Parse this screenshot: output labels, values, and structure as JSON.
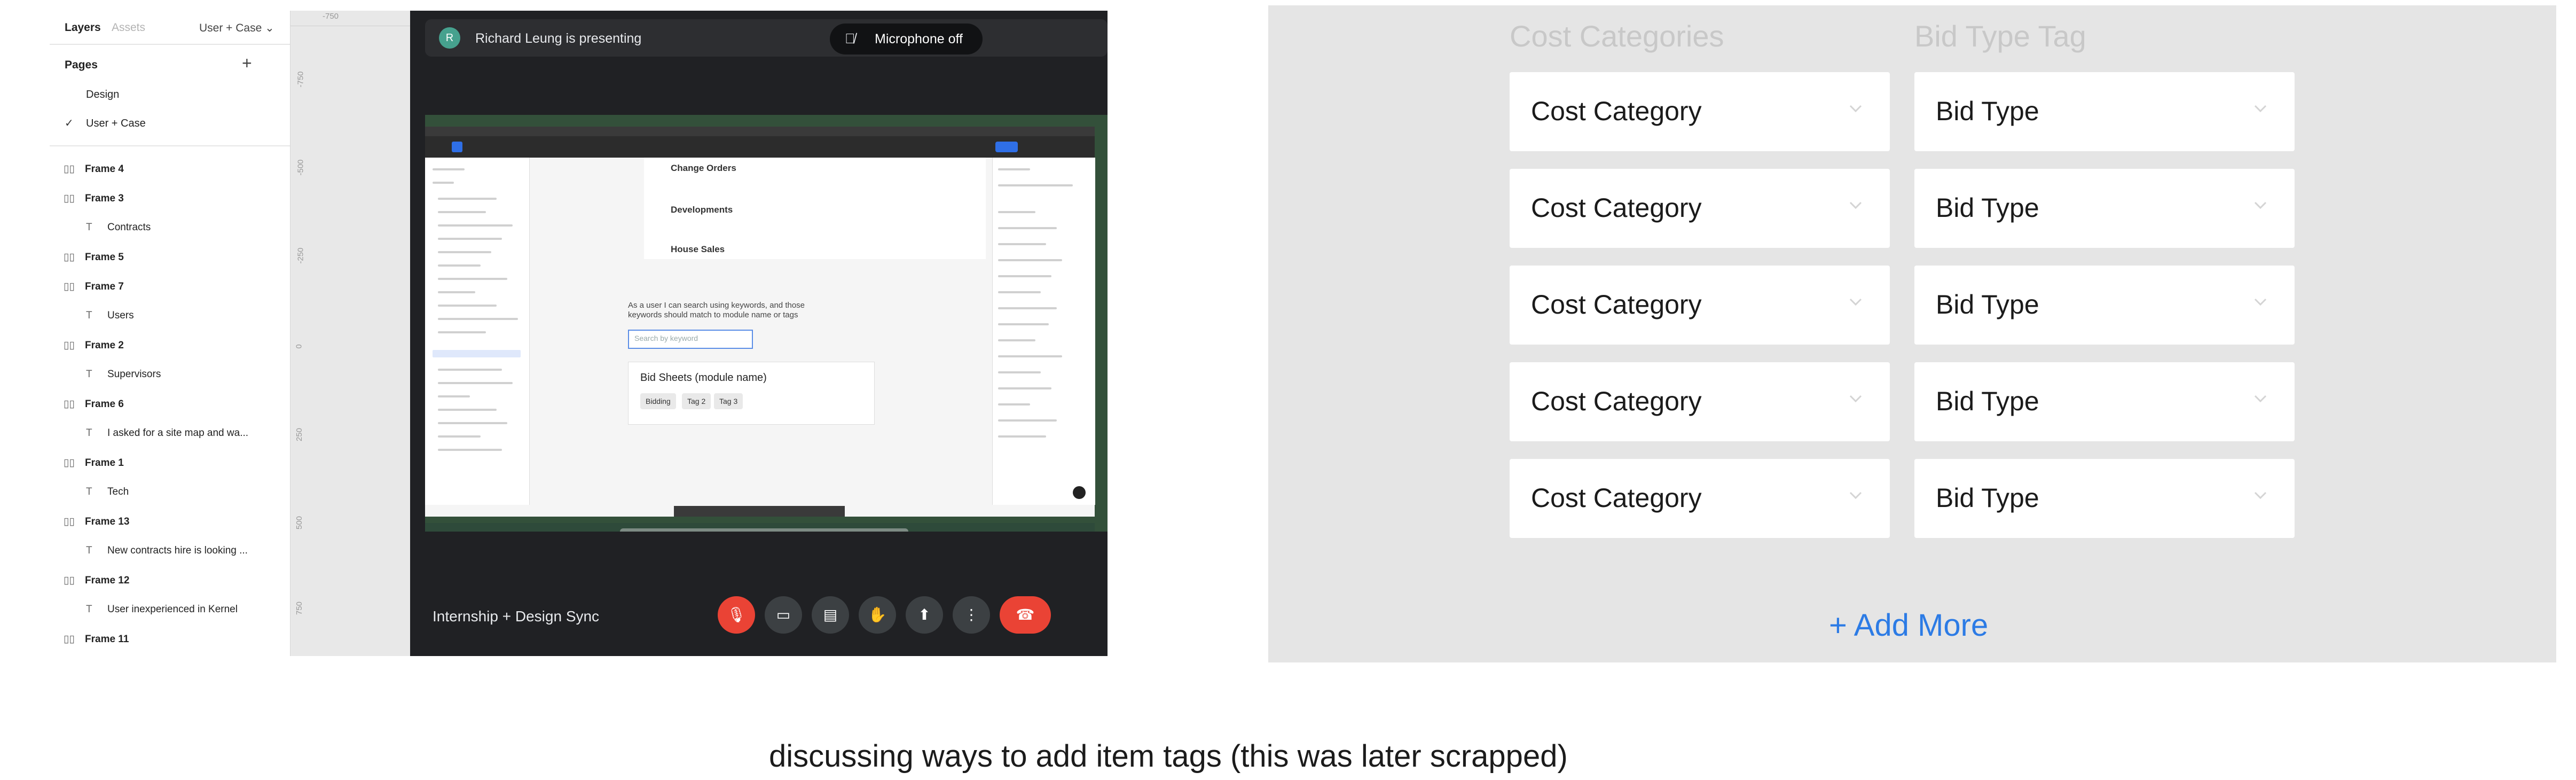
{
  "figma": {
    "tabs": [
      "Layers",
      "Assets"
    ],
    "page_selector": "User + Case",
    "pages_header": "Pages",
    "pages": [
      "Design",
      "User + Case"
    ],
    "layers": [
      {
        "type": "frame",
        "label": "Frame 4"
      },
      {
        "type": "frame",
        "label": "Frame 3"
      },
      {
        "type": "text",
        "label": "Contracts"
      },
      {
        "type": "frame",
        "label": "Frame 5"
      },
      {
        "type": "frame",
        "label": "Frame 7"
      },
      {
        "type": "text",
        "label": "Users"
      },
      {
        "type": "frame",
        "label": "Frame 2"
      },
      {
        "type": "text",
        "label": "Supervisors"
      },
      {
        "type": "frame",
        "label": "Frame 6"
      },
      {
        "type": "text",
        "label": "I asked for a site map and wa..."
      },
      {
        "type": "frame",
        "label": "Frame 1"
      },
      {
        "type": "text",
        "label": "Tech"
      },
      {
        "type": "frame",
        "label": "Frame 13"
      },
      {
        "type": "text",
        "label": "New contracts hire is looking ..."
      },
      {
        "type": "frame",
        "label": "Frame 12"
      },
      {
        "type": "text",
        "label": "User inexperienced in Kernel"
      },
      {
        "type": "frame",
        "label": "Frame 11"
      }
    ],
    "ruler_labels": [
      "-750",
      "-750",
      "-500",
      "-250",
      "0",
      "250",
      "500",
      "750"
    ]
  },
  "meet": {
    "avatar_initial": "R",
    "presenter": "Richard Leung is presenting",
    "mic_status": "Microphone off",
    "meeting_name": "Internship + Design Sync",
    "shared": {
      "nav_items": [
        "Change Orders",
        "Developments",
        "House Sales"
      ],
      "description": "As a user I can search using keywords, and those keywords should match to module name or tags",
      "search_placeholder": "Search by keyword",
      "card_title": "Bid Sheets (module name)",
      "tags": [
        "Bidding",
        "Tag 2",
        "Tag 3"
      ]
    }
  },
  "mockup": {
    "col1_header": "Cost Categories",
    "col2_header": "Bid Type Tag",
    "rows": [
      {
        "cost": "Cost Category",
        "bid": "Bid Type"
      },
      {
        "cost": "Cost Category",
        "bid": "Bid Type"
      },
      {
        "cost": "Cost Category",
        "bid": "Bid Type"
      },
      {
        "cost": "Cost Category",
        "bid": "Bid Type"
      },
      {
        "cost": "Cost Category",
        "bid": "Bid Type"
      }
    ],
    "add_more": "+ Add More",
    "accent": "#2c7be5"
  },
  "caption": "discussing ways to add item tags (this was later scrapped)"
}
